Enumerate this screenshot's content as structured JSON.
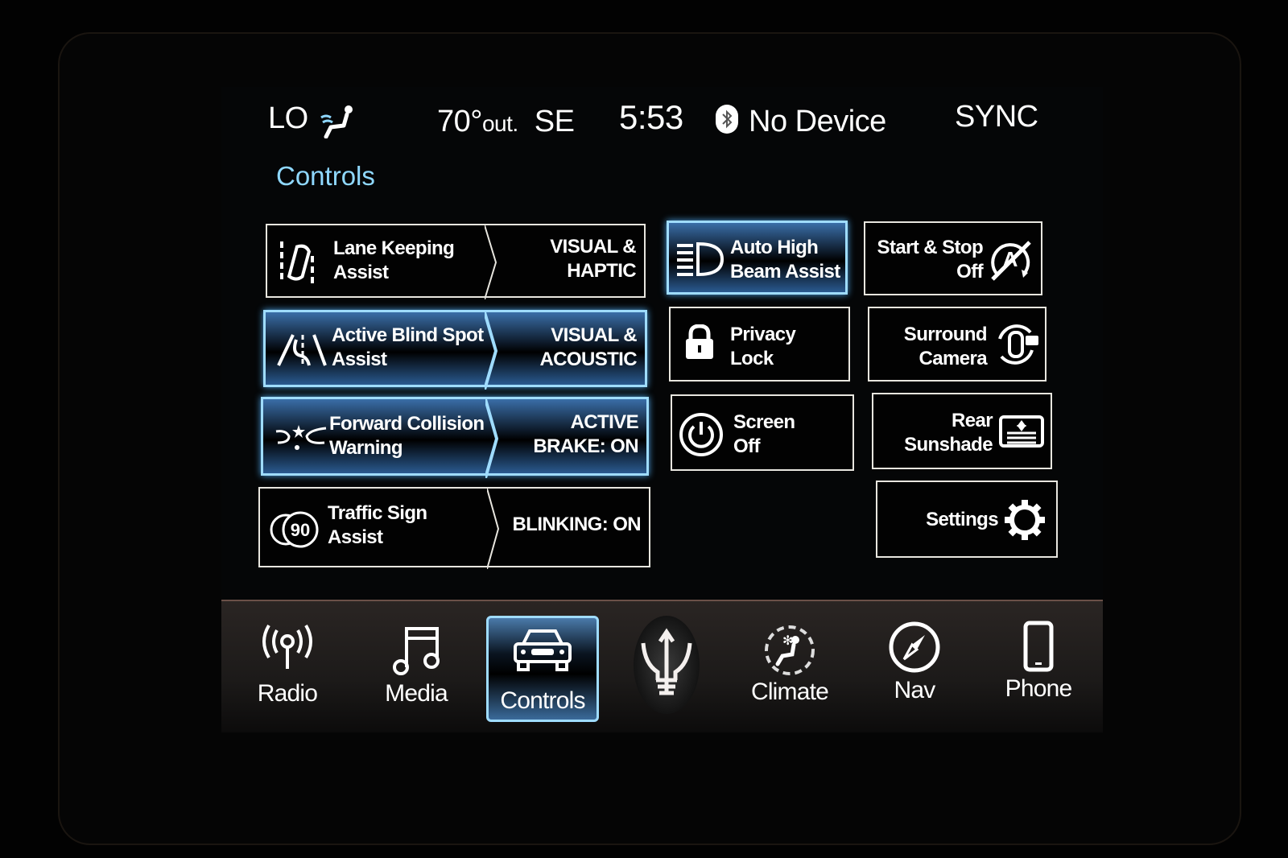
{
  "status_bar": {
    "fan_level": "LO",
    "temperature": "70°",
    "temperature_suffix": "out.",
    "compass": "SE",
    "time": "5:53",
    "bluetooth_status": "No Device",
    "system_name": "SYNC",
    "icons": [
      "seat-airflow-icon",
      "bluetooth-icon"
    ]
  },
  "page": {
    "title": "Controls",
    "accent_color": "#8fd8ff"
  },
  "left_tiles": [
    {
      "label": "Lane Keeping Assist",
      "line1": "Lane Keeping",
      "line2": "Assist",
      "value1": "VISUAL &",
      "value2": "HAPTIC",
      "active": false,
      "icon": "lane-keeping-icon"
    },
    {
      "label": "Active Blind Spot Assist",
      "line1": "Active Blind Spot",
      "line2": "Assist",
      "value1": "VISUAL &",
      "value2": "ACOUSTIC",
      "active": true,
      "icon": "blind-spot-icon"
    },
    {
      "label": "Forward Collision Warning",
      "line1": "Forward Collision",
      "line2": "Warning",
      "value1": "ACTIVE",
      "value2": "BRAKE: ON",
      "active": true,
      "icon": "forward-collision-icon"
    },
    {
      "label": "Traffic Sign Assist",
      "line1": "Traffic Sign",
      "line2": "Assist",
      "value1": "BLINKING: ON",
      "value2": "",
      "active": false,
      "icon": "speed-sign-icon",
      "icon_text": "90"
    }
  ],
  "middle_tiles": [
    {
      "line1": "Auto High",
      "line2": "Beam Assist",
      "active": true,
      "icon": "high-beam-icon"
    },
    {
      "line1": "Privacy",
      "line2": "Lock",
      "active": false,
      "icon": "lock-icon"
    },
    {
      "line1": "Screen",
      "line2": "Off",
      "active": false,
      "icon": "power-icon"
    }
  ],
  "right_tiles": [
    {
      "line1": "Start & Stop",
      "line2": "Off",
      "active": false,
      "icon": "auto-start-stop-off-icon"
    },
    {
      "line1": "Surround",
      "line2": "Camera",
      "active": false,
      "icon": "surround-camera-icon"
    },
    {
      "line1": "Rear",
      "line2": "Sunshade",
      "active": false,
      "icon": "sunshade-icon"
    },
    {
      "line1": "Settings",
      "line2": "",
      "active": false,
      "icon": "gear-icon"
    }
  ],
  "nav_bar": {
    "items": [
      {
        "label": "Radio",
        "icon": "radio-icon",
        "active": false
      },
      {
        "label": "Media",
        "icon": "music-note-icon",
        "active": false
      },
      {
        "label": "Controls",
        "icon": "car-icon",
        "active": true
      },
      {
        "label": "Climate",
        "icon": "climate-icon",
        "active": false
      },
      {
        "label": "Nav",
        "icon": "compass-icon",
        "active": false
      },
      {
        "label": "Phone",
        "icon": "phone-icon",
        "active": false
      }
    ],
    "logo": "trident-logo-icon",
    "active_color": "#9fdcff"
  }
}
